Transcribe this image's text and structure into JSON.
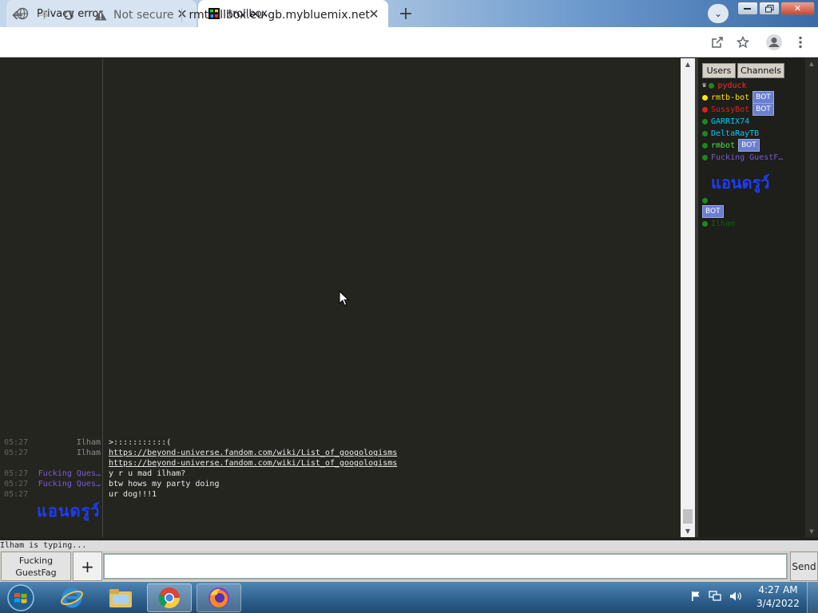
{
  "browser": {
    "tabs": [
      {
        "title": "Privacy error",
        "icon": "globe-icon"
      },
      {
        "title": "trollbox",
        "icon": "trollbox-favicon"
      }
    ],
    "new_tab": "+",
    "tab_search": "⌄",
    "security_label": "Not secure",
    "url": "rmtrollbox.eu-gb.mybluemix.net"
  },
  "chat": {
    "messages": [
      {
        "time": "05:27",
        "nick": "Ilham",
        "nick_color": "#8a8a8a",
        "text": ">:::::::::::(",
        "is_link": false
      },
      {
        "time": "05:27",
        "nick": "Ilham",
        "nick_color": "#8a8a8a",
        "text": "https://beyond-universe.fandom.com/wiki/List_of_googologisms",
        "is_link": true
      },
      {
        "time": "",
        "nick": "",
        "nick_color": "#8a8a8a",
        "text": "https://beyond-universe.fandom.com/wiki/List_of_googologisms",
        "is_link": true
      },
      {
        "time": "05:27",
        "nick": "Fucking Ques…",
        "nick_color": "#7a5ad8",
        "text": "y r u mad ilham?",
        "is_link": false
      },
      {
        "time": "05:27",
        "nick": "Fucking Ques…",
        "nick_color": "#7a5ad8",
        "text": "btw hows my party doing",
        "is_link": false
      },
      {
        "time": "05:27",
        "nick": "",
        "nick_color": "#7a5ad8",
        "text": "ur dog!!!1",
        "is_link": false
      }
    ],
    "big_name": "แอนดรูว์",
    "typing_status": "Ilham is typing..."
  },
  "sidebar": {
    "users_button": "Users",
    "channels_button": "Channels",
    "users": [
      {
        "name": "pyduck",
        "color": "#ff2a2a",
        "dot": "#1a8a1a",
        "crown": true,
        "bot": false
      },
      {
        "name": "rmtb-bot",
        "color": "#ffe020",
        "dot": "#ffe020",
        "crown": false,
        "bot": true
      },
      {
        "name": "SussyBot",
        "color": "#e02020",
        "dot": "#e02020",
        "crown": false,
        "bot": true
      },
      {
        "name": "GARRIX74",
        "color": "#00c8ff",
        "dot": "#1a8a1a",
        "crown": false,
        "bot": false
      },
      {
        "name": "DeltaRayTB",
        "color": "#00c8ff",
        "dot": "#1a8a1a",
        "crown": false,
        "bot": false
      },
      {
        "name": "rmbot",
        "color": "#4ae04a",
        "dot": "#1a8a1a",
        "crown": false,
        "bot": true
      },
      {
        "name": "Fucking GuestF…",
        "color": "#7a5ad8",
        "dot": "#1a8a1a",
        "crown": false,
        "bot": false
      }
    ],
    "big_name": "แอนดรูว์",
    "empty_user_bot": "BOT",
    "last_user": "Ilham",
    "bot_label": "BOT"
  },
  "composer": {
    "nick_button": "Fucking GuestFag",
    "plus": "+",
    "input_value": "",
    "send": "Send"
  },
  "taskbar": {
    "time": "4:27 AM",
    "date": "3/4/2022"
  }
}
